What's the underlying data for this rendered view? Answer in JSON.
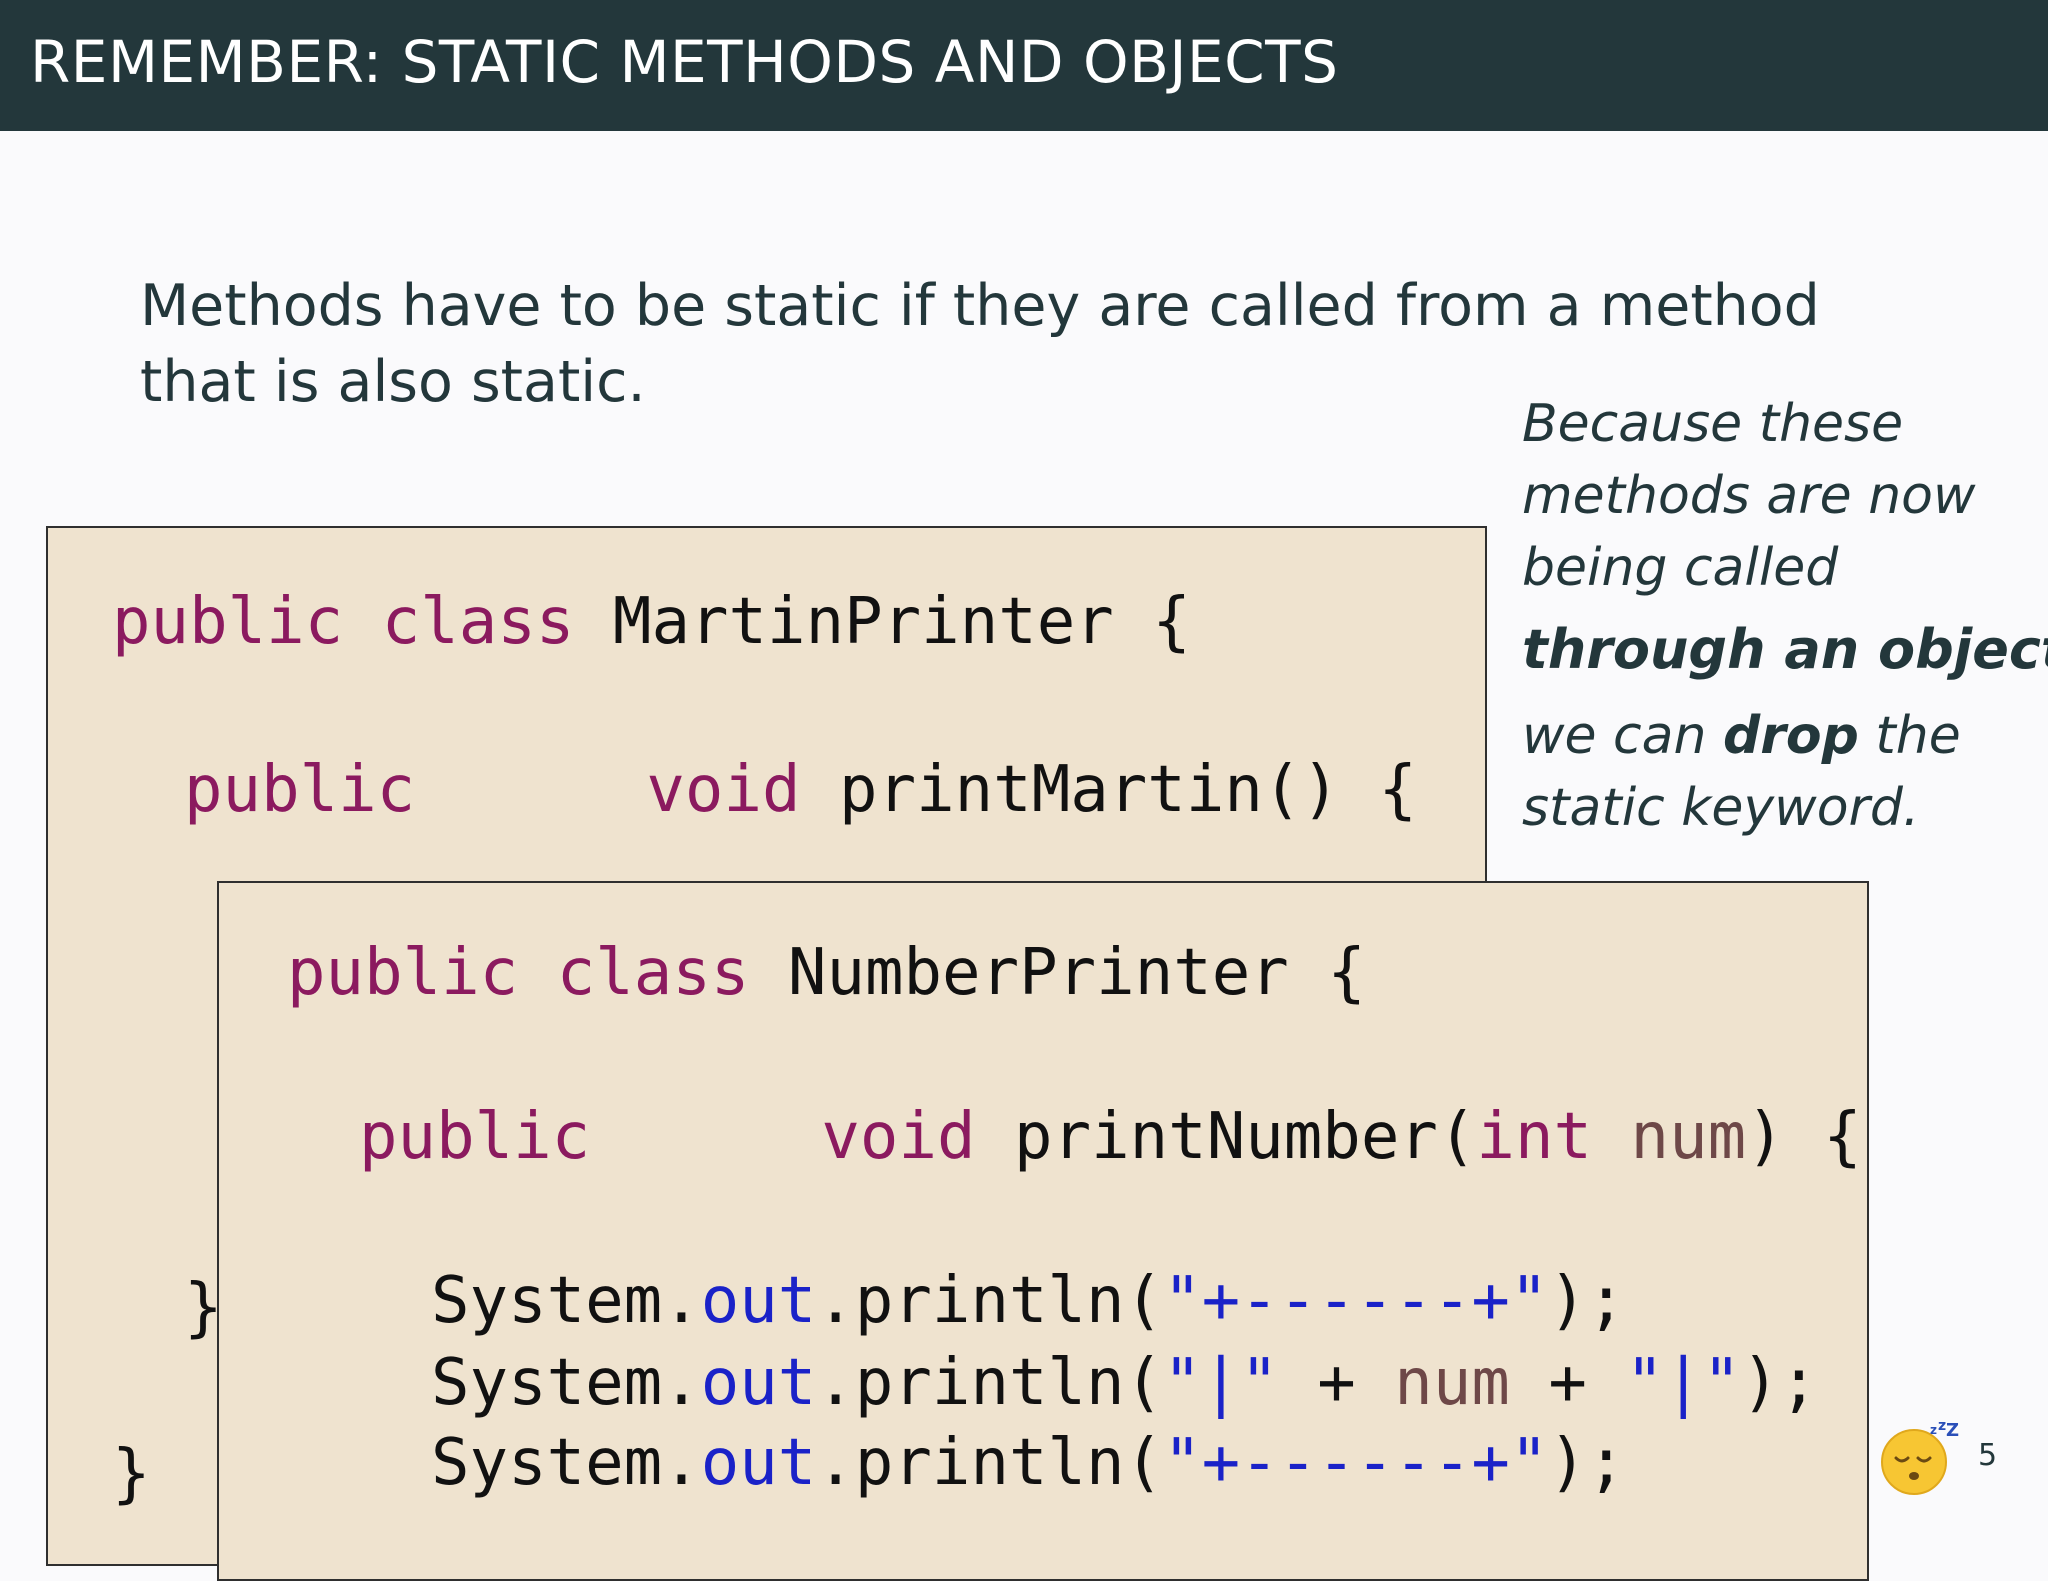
{
  "slide": {
    "title": "REMEMBER: STATIC METHODS AND OBJECTS",
    "intro_line1": "Methods have to be static if they are called from a method",
    "intro_line2": "that is also static.",
    "page_number": "5"
  },
  "side_note": {
    "line1": "Because these",
    "line2": "methods are now",
    "line3": "being called",
    "emphasis": "through an object",
    "line5_pre": "we can ",
    "line5_bold": "drop",
    "line5_post": " the",
    "line6": "static keyword."
  },
  "code_martin": {
    "l1_kw1": "public",
    "l1_kw2": "class",
    "l1_name": "MartinPrinter",
    "l1_brace": "{",
    "l2_kw": "public",
    "l2_void": "void",
    "l2_method": "printMartin() {",
    "l3_close": "}",
    "l4_close": "}"
  },
  "code_number": {
    "l1_kw1": "public",
    "l1_kw2": "class",
    "l1_name": "NumberPrinter",
    "l1_brace": "{",
    "l2_kw": "public",
    "l2_void": "void",
    "l2_method": "printNumber(",
    "l2_int": "int",
    "l2_param": "num",
    "l2_end": ") {",
    "sys": "System.",
    "out": "out",
    "println": ".println(",
    "str_border": "\"+------+\"",
    "str_pipe": "\"|\"",
    "plus": " + ",
    "num": "num",
    "end": ");"
  },
  "icons": {
    "sleeping_face": "sleeping-face-icon"
  }
}
